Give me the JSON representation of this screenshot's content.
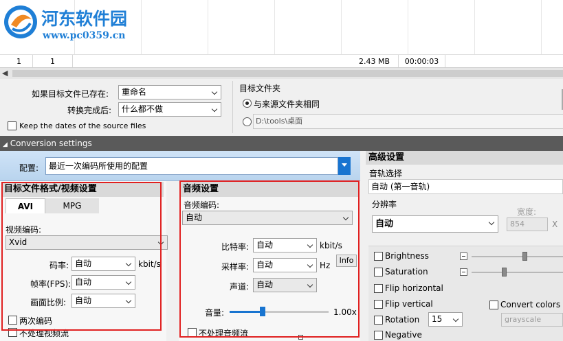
{
  "watermark": {
    "title": "河东软件园",
    "url": "www.pc0359.cn"
  },
  "file_row": {
    "c1": "1",
    "c2": "1",
    "size": "2.43 MB",
    "duration": "00:00:03"
  },
  "output_options": {
    "if_exists_label": "如果目标文件已存在:",
    "if_exists_value": "重命名",
    "after_convert_label": "转换完成后:",
    "after_convert_value": "什么都不做",
    "keep_dates_label": "Keep the dates of the source files",
    "target_folder_label": "目标文件夹",
    "same_as_source_label": "与来源文件夹相同",
    "custom_path": "D:\\tools\\桌面"
  },
  "conversion_header": "Conversion settings",
  "config": {
    "label": "配置:",
    "value": "最近一次编码所使用的配置"
  },
  "video": {
    "header": "目标文件格式/视频设置",
    "tab_avi": "AVI",
    "tab_mpg": "MPG",
    "codec_label": "视频编码:",
    "codec_value": "Xvid",
    "bitrate_label": "码率:",
    "bitrate_value": "自动",
    "bitrate_unit": "kbit/s",
    "fps_label": "帧率(FPS):",
    "fps_value": "自动",
    "aspect_label": "画面比例:",
    "aspect_value": "自动",
    "twopass_label": "两次编码",
    "novideo_label": "不处理视频流"
  },
  "audio": {
    "header": "音频设置",
    "codec_label": "音频编码:",
    "codec_value": "自动",
    "bitrate_label": "比特率:",
    "bitrate_value": "自动",
    "bitrate_unit": "kbit/s",
    "samplerate_label": "采样率:",
    "samplerate_value": "自动",
    "samplerate_unit": "Hz",
    "info_label": "Info",
    "channels_label": "声道:",
    "channels_value": "自动",
    "volume_label": "音量:",
    "volume_value": "1.00x",
    "volume_level": 0.33,
    "noaudio_label": "不处理音频流"
  },
  "advanced": {
    "header": "高级设置",
    "track_label": "音轨选择",
    "track_value": "自动 (第一音轨)",
    "resolution_label": "分辨率",
    "resolution_value": "自动",
    "width_label": "宽度:",
    "width_value": "854",
    "x_label": "X",
    "brightness_label": "Brightness",
    "saturation_label": "Saturation",
    "flip_h_label": "Flip horizontal",
    "flip_v_label": "Flip vertical",
    "rotation_label": "Rotation",
    "rotation_value": "15",
    "negative_label": "Negative",
    "convert_colors_label": "Convert colors to",
    "color_mode_value": "grayscale"
  }
}
